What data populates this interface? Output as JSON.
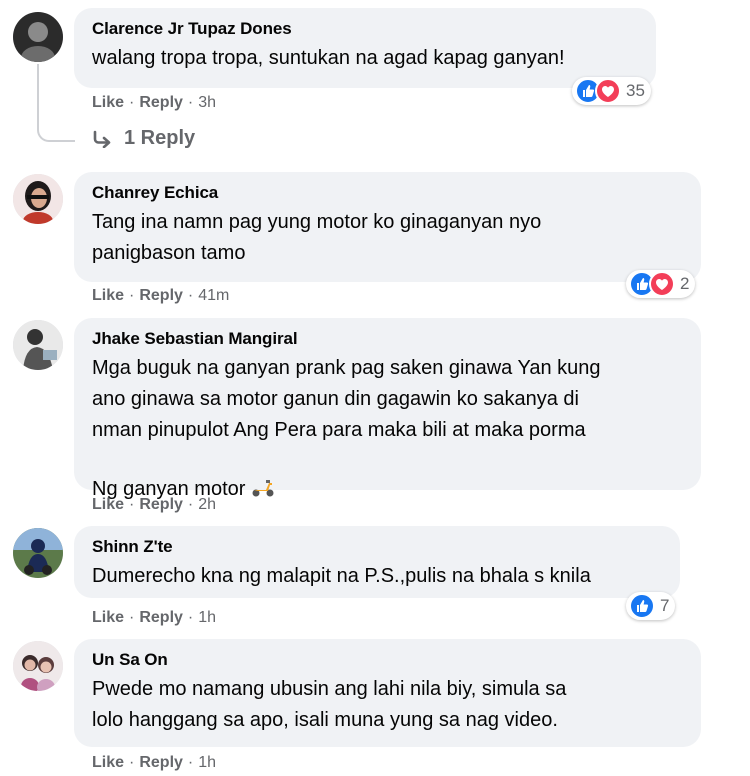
{
  "comments": [
    {
      "author": "Clarence Jr Tupaz Dones",
      "text": "walang tropa tropa, suntukan na agad kapag ganyan!",
      "like": "Like",
      "reply": "Reply",
      "time": "3h",
      "reactions": [
        "like",
        "love"
      ],
      "reaction_count": "35",
      "replies_label": "1 Reply"
    },
    {
      "author": "Chanrey Echica",
      "text": "Tang ina namn pag yung motor ko ginaganyan nyo\npanigbason tamo",
      "like": "Like",
      "reply": "Reply",
      "time": "41m",
      "reactions": [
        "like",
        "love"
      ],
      "reaction_count": "2"
    },
    {
      "author": "Jhake Sebastian Mangiral",
      "text": "Mga buguk na ganyan prank pag saken ginawa Yan kung\nano ginawa sa motor ganun din gagawin ko sakanya di\nnman pinupulot Ang Pera para maka bili at maka porma\nNg ganyan motor",
      "emoji": "scooter-icon",
      "like": "Like",
      "reply": "Reply",
      "time": "2h"
    },
    {
      "author": "Shinn Z'te",
      "text": "Dumerecho kna ng malapit na P.S.,pulis na bhala s knila",
      "like": "Like",
      "reply": "Reply",
      "time": "1h",
      "reactions": [
        "like"
      ],
      "reaction_count": "7"
    },
    {
      "author": "Un Sa On",
      "text": "Pwede mo namang ubusin ang lahi nila biy, simula sa\nlolo hanggang sa apo, isali muna yung sa nag video.",
      "like": "Like",
      "reply": "Reply",
      "time": "1h"
    }
  ],
  "colors": {
    "bubble": "#f0f2f5",
    "meta_text": "#65676b",
    "like_blue": "#1877f2",
    "love_red": "#f33e58"
  }
}
